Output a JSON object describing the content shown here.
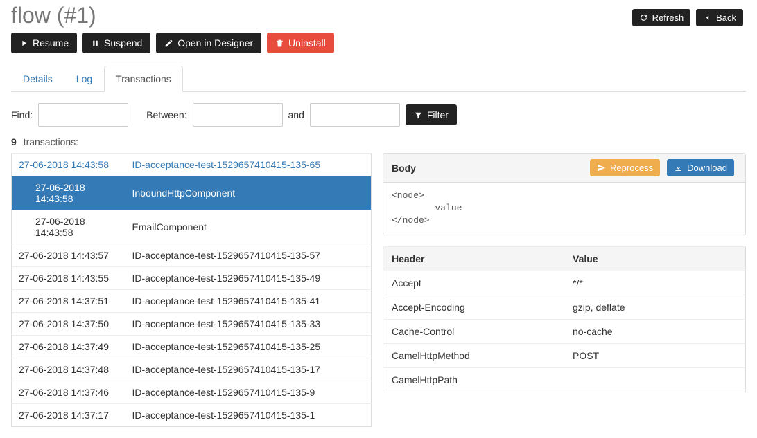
{
  "title": "flow (#1)",
  "top_buttons": {
    "refresh": "Refresh",
    "back": "Back"
  },
  "actions": {
    "resume": "Resume",
    "suspend": "Suspend",
    "open_designer": "Open in Designer",
    "uninstall": "Uninstall"
  },
  "tabs": {
    "details": "Details",
    "log": "Log",
    "transactions": "Transactions"
  },
  "filter": {
    "find_label": "Find:",
    "between_label": "Between:",
    "and_label": "and",
    "button": "Filter"
  },
  "count": {
    "value": "9",
    "label": "transactions:"
  },
  "tx_top": {
    "time": "27-06-2018 14:43:58",
    "id": "ID-acceptance-test-1529657410415-135-65"
  },
  "tx_sub": [
    {
      "time": "27-06-2018 14:43:58",
      "name": "InboundHttpComponent"
    },
    {
      "time": "27-06-2018 14:43:58",
      "name": "EmailComponent"
    }
  ],
  "tx_rows": [
    {
      "time": "27-06-2018 14:43:57",
      "id": "ID-acceptance-test-1529657410415-135-57"
    },
    {
      "time": "27-06-2018 14:43:55",
      "id": "ID-acceptance-test-1529657410415-135-49"
    },
    {
      "time": "27-06-2018 14:37:51",
      "id": "ID-acceptance-test-1529657410415-135-41"
    },
    {
      "time": "27-06-2018 14:37:50",
      "id": "ID-acceptance-test-1529657410415-135-33"
    },
    {
      "time": "27-06-2018 14:37:49",
      "id": "ID-acceptance-test-1529657410415-135-25"
    },
    {
      "time": "27-06-2018 14:37:48",
      "id": "ID-acceptance-test-1529657410415-135-17"
    },
    {
      "time": "27-06-2018 14:37:46",
      "id": "ID-acceptance-test-1529657410415-135-9"
    },
    {
      "time": "27-06-2018 14:37:17",
      "id": "ID-acceptance-test-1529657410415-135-1"
    }
  ],
  "body_panel": {
    "label": "Body",
    "reprocess": "Reprocess",
    "download": "Download",
    "content": "<node>\n        value\n</node>"
  },
  "hv": {
    "header_col": "Header",
    "value_col": "Value",
    "rows": [
      {
        "h": "Accept",
        "v": "*/*"
      },
      {
        "h": "Accept-Encoding",
        "v": "gzip, deflate"
      },
      {
        "h": "Cache-Control",
        "v": "no-cache"
      },
      {
        "h": "CamelHttpMethod",
        "v": "POST"
      },
      {
        "h": "CamelHttpPath",
        "v": ""
      }
    ]
  }
}
